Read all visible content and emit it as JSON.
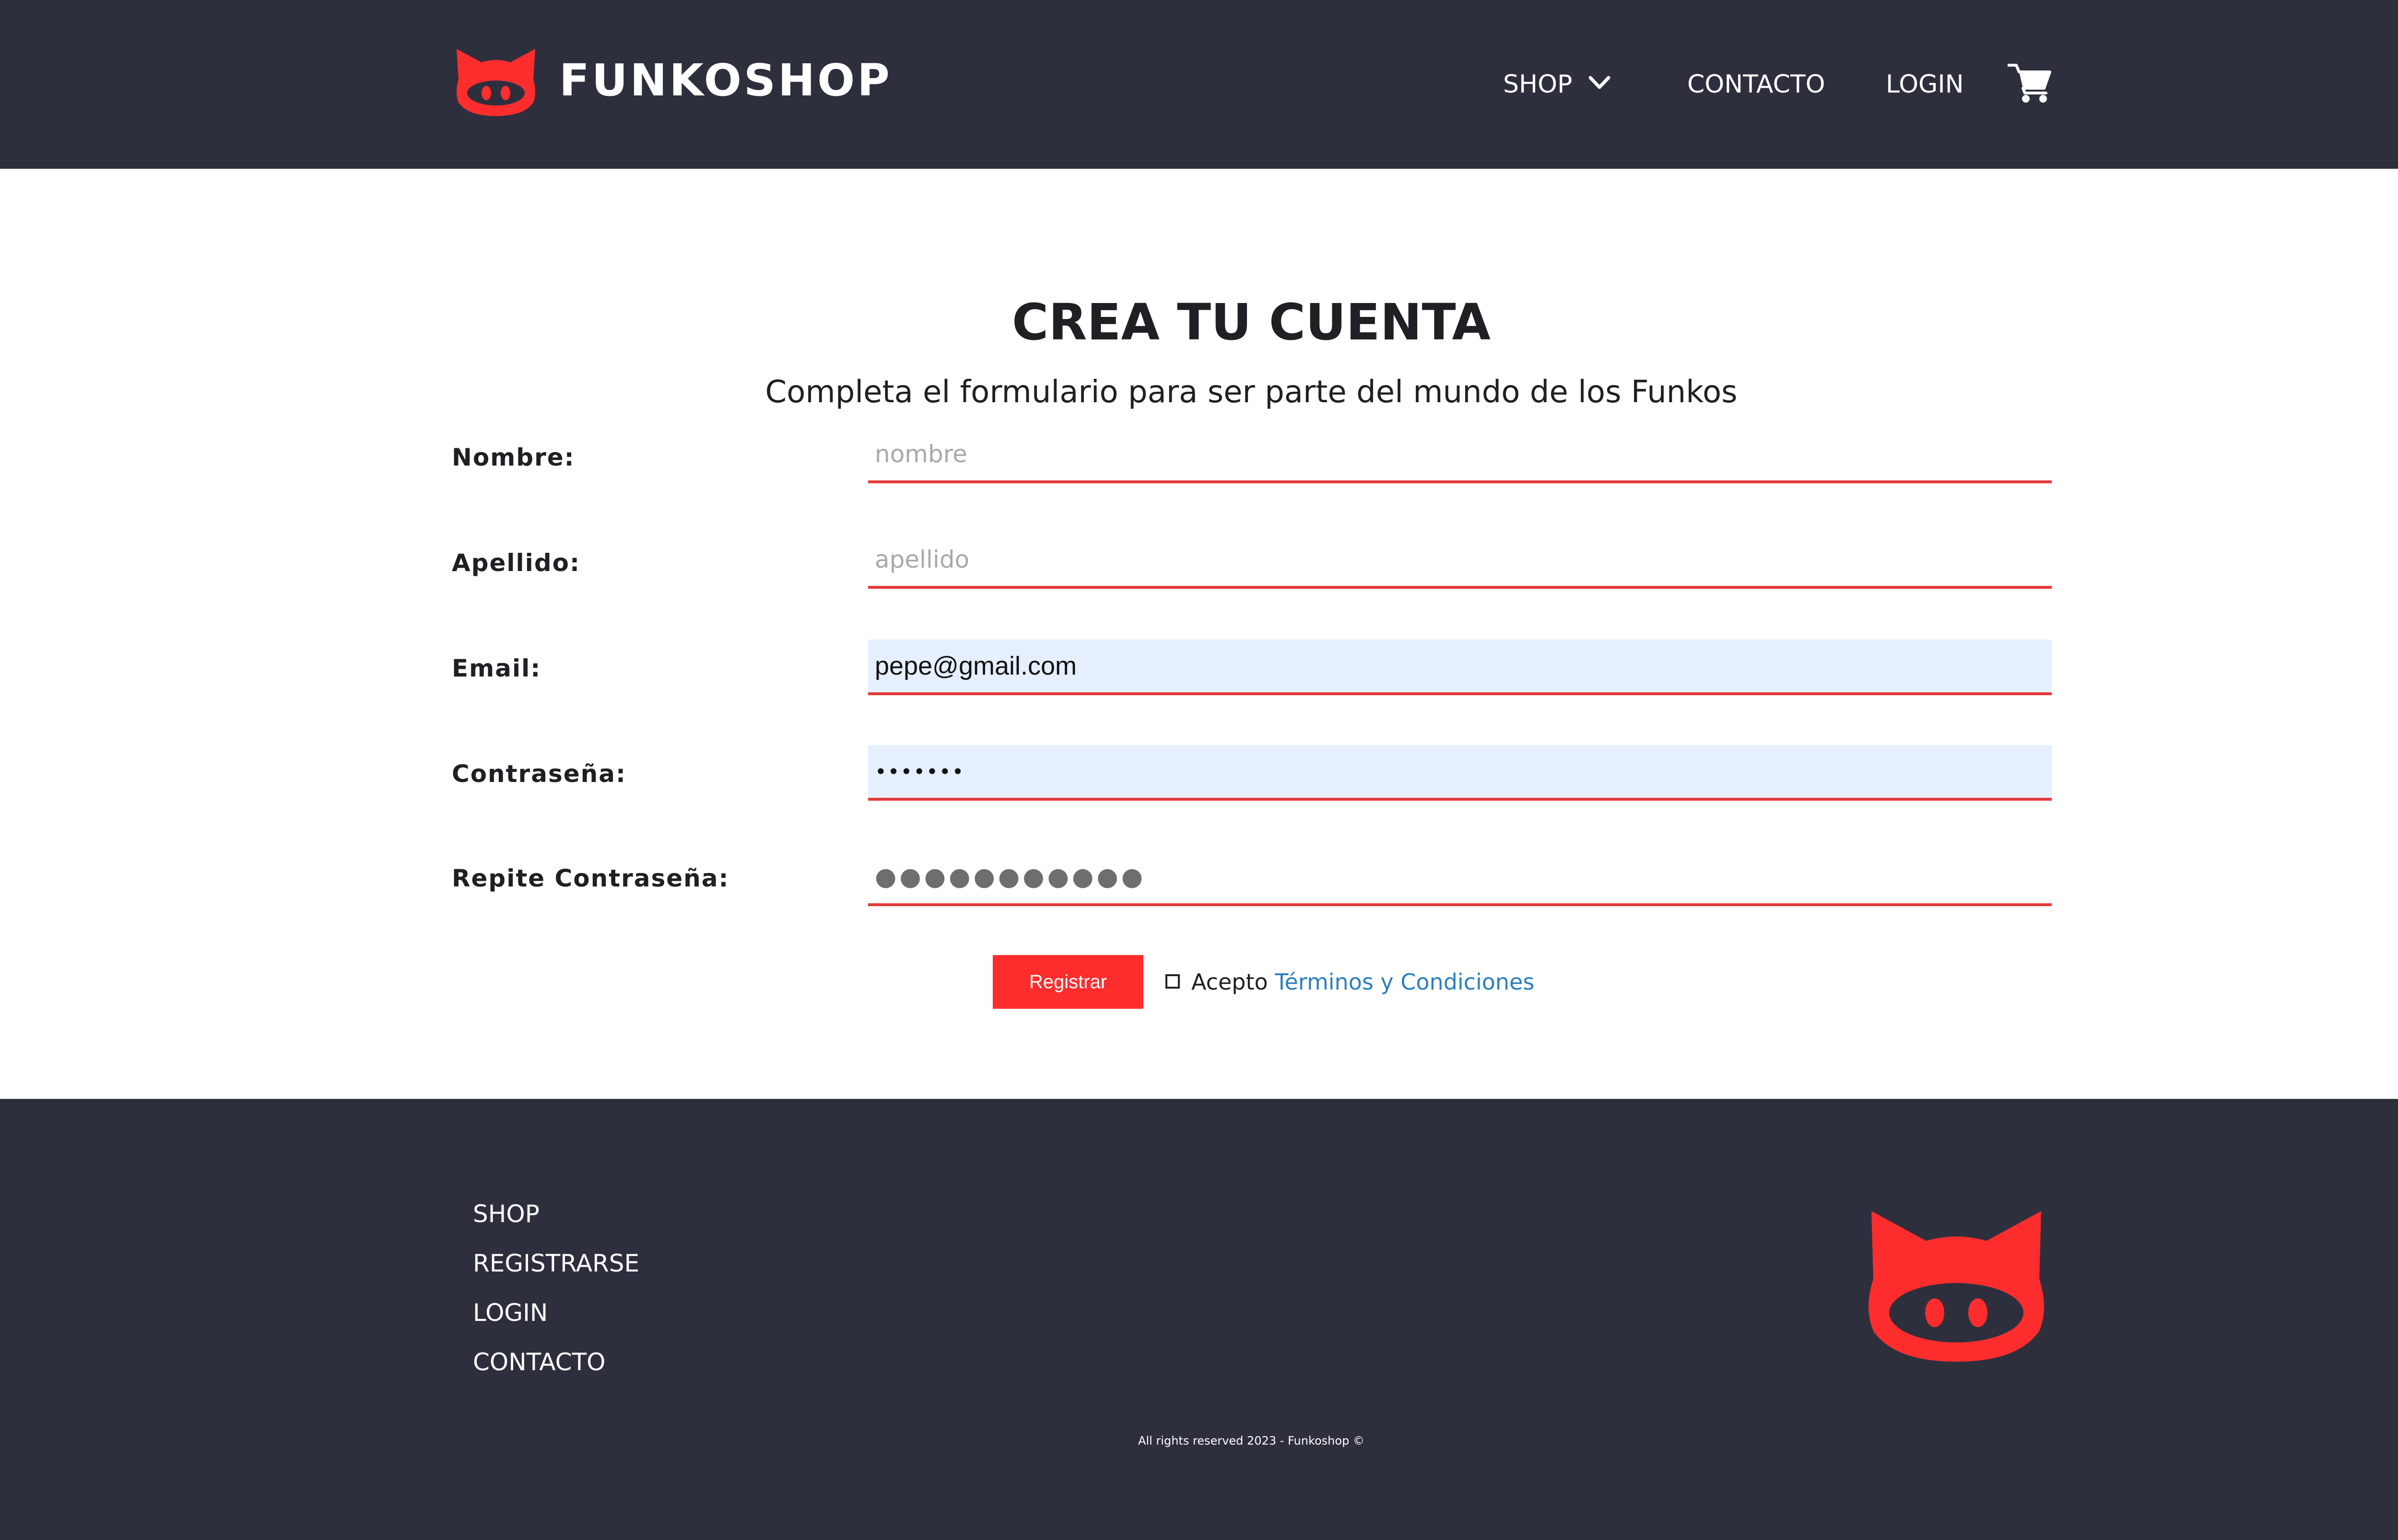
{
  "header": {
    "brand": "FUNKOSHOP",
    "nav": {
      "shop": "SHOP",
      "contact": "CONTACTO",
      "login": "LOGIN"
    },
    "icons": {
      "logo": "funko-cat-logo-icon",
      "dropdown": "chevron-down-icon",
      "cart": "shopping-cart-icon"
    }
  },
  "main": {
    "title": "CREA TU CUENTA",
    "subtitle": "Completa el formulario para ser parte del mundo de los Funkos",
    "form": {
      "nombre": {
        "label": "Nombre:",
        "placeholder": "nombre",
        "value": ""
      },
      "apellido": {
        "label": "Apellido:",
        "placeholder": "apellido",
        "value": ""
      },
      "email": {
        "label": "Email:",
        "placeholder": "",
        "value": "pepe@gmail.com"
      },
      "password": {
        "label": "Contraseña:",
        "masked": "•••••••"
      },
      "repeat_password": {
        "label": "Repite Contraseña:",
        "masked": "●●●●●●●●●●●"
      },
      "submit_label": "Registrar",
      "terms_prefix": "Acepto",
      "terms_link": "Términos y Condiciones"
    }
  },
  "footer": {
    "links": [
      "SHOP",
      "REGISTRARSE",
      "LOGIN",
      "CONTACTO"
    ],
    "copyright": "All rights reserved 2023 - Funkoshop ©"
  },
  "colors": {
    "header_bg": "#2e2f3d",
    "accent_red": "#fd2d2d",
    "input_underline": "#e53a3a",
    "autofill_bg": "#e6effd",
    "link_blue": "#2b7ec1"
  }
}
